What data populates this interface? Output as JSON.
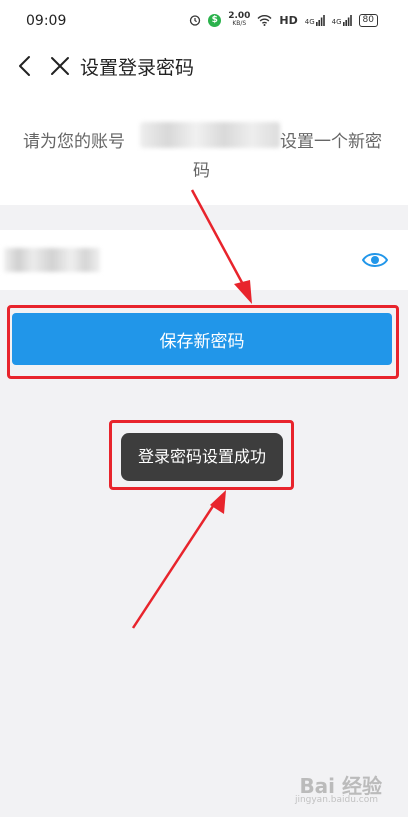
{
  "status_bar": {
    "time": "09:09",
    "speed_value": "2.00",
    "speed_unit": "KB/S",
    "hd_label": "HD",
    "signal1": "4G",
    "signal2": "4G",
    "battery": "80"
  },
  "nav": {
    "title": "设置登录密码"
  },
  "info": {
    "prefix": "请为您的账号",
    "suffix": "设置一个新密",
    "wrap": "码"
  },
  "save_button_label": "保存新密码",
  "toast_message": "登录密码设置成功",
  "watermark": {
    "text": "Bai 经验",
    "sub": "jingyan.baidu.com"
  },
  "colors": {
    "primary": "#2196e9",
    "highlight": "#e8242c",
    "toast_bg": "#3d3d3d"
  }
}
